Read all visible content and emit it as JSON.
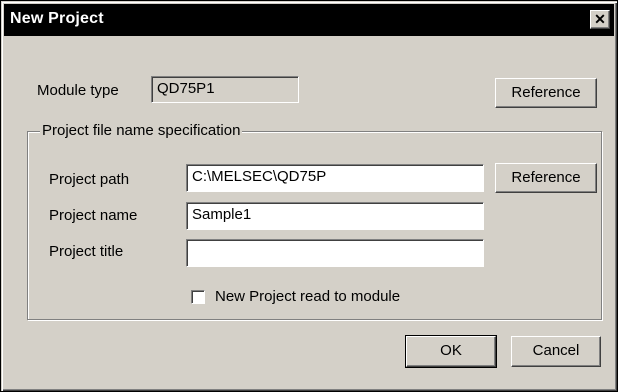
{
  "dialog": {
    "title": "New Project",
    "close_glyph": "✕"
  },
  "module": {
    "label": "Module type",
    "value": "QD75P1",
    "reference_label": "Reference"
  },
  "group": {
    "legend": "Project file name specification",
    "path_label": "Project path",
    "path_value": "C:\\MELSEC\\QD75P",
    "path_reference_label": "Reference",
    "name_label": "Project name",
    "name_value": "Sample1",
    "title_label": "Project title",
    "title_value": "",
    "checkbox_label": "New Project read to module",
    "checkbox_checked": false
  },
  "buttons": {
    "ok": "OK",
    "cancel": "Cancel"
  }
}
